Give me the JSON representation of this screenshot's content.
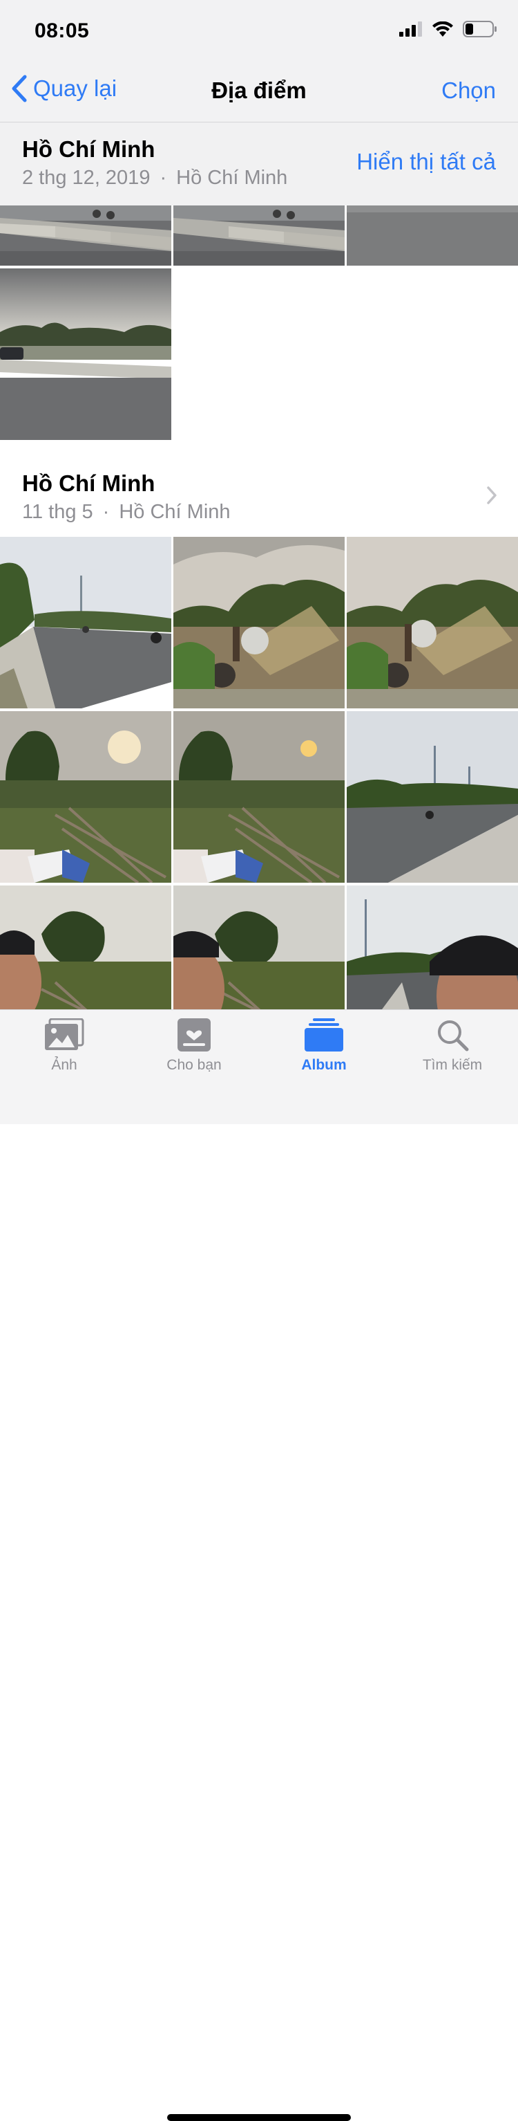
{
  "status": {
    "time": "08:05"
  },
  "nav": {
    "back_label": "Quay lại",
    "title": "Địa điểm",
    "select_label": "Chọn"
  },
  "sections": [
    {
      "title": "Hồ Chí Minh",
      "date": "2 thg 12, 2019",
      "location": "Hồ Chí Minh",
      "action_label": "Hiển thị tất cả"
    },
    {
      "title": "Hồ Chí Minh",
      "date": "11 thg 5",
      "location": "Hồ Chí Minh"
    }
  ],
  "separator": "·",
  "tabs": [
    {
      "label": "Ảnh",
      "icon": "photos-icon"
    },
    {
      "label": "Cho bạn",
      "icon": "for-you-icon"
    },
    {
      "label": "Album",
      "icon": "album-icon",
      "active": true
    },
    {
      "label": "Tìm kiếm",
      "icon": "search-icon"
    }
  ],
  "colors": {
    "accent": "#2f7bf5",
    "inactive": "#8f8f94",
    "secondary_text": "#8e8e93"
  }
}
